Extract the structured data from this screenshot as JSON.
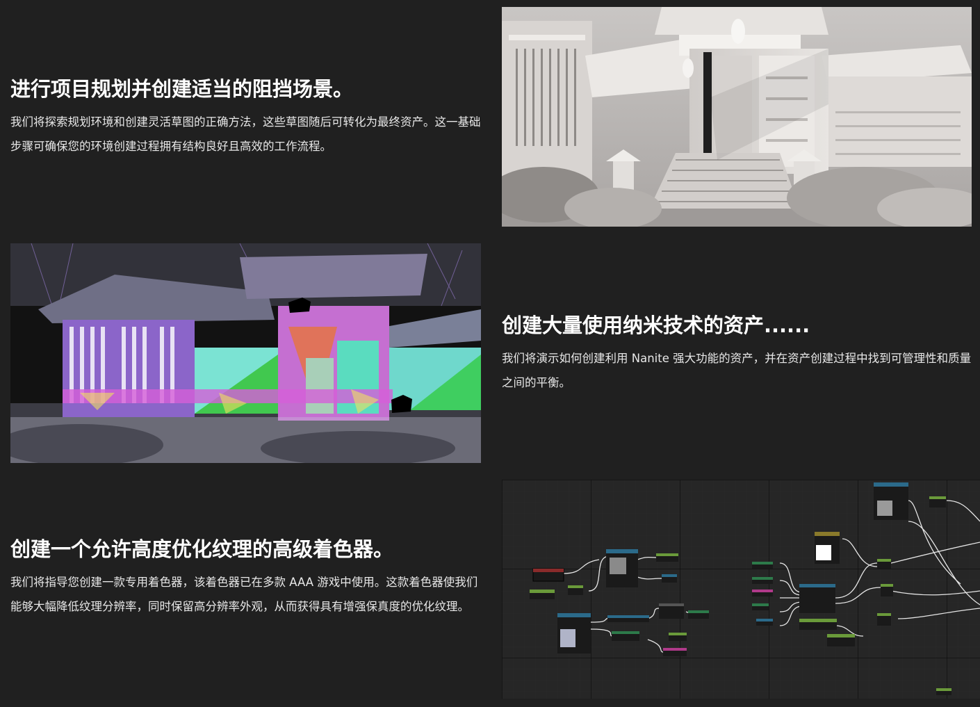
{
  "sections": [
    {
      "heading": "进行项目规划并创建适当的阻挡场景。",
      "body": "我们将探索规划环境和创建灵活草图的正确方法，这些草图随后可转化为最终资产。这一基础步骤可确保您的环境创建过程拥有结构良好且高效的工作流程。",
      "image": "clay-render-japanese-building"
    },
    {
      "heading": "创建大量使用纳米技术的资产......",
      "body": "我们将演示如何创建利用 Nanite 强大功能的资产，并在资产创建过程中找到可管理性和质量之间的平衡。",
      "image": "nanite-triangle-visualization"
    },
    {
      "heading": "创建一个允许高度优化纹理的高级着色器。",
      "body": "我们将指导您创建一款专用着色器，该着色器已在多款 AAA 游戏中使用。这款着色器使我们能够大幅降低纹理分辨率，同时保留高分辨率外观，从而获得具有增强保真度的优化纹理。",
      "image": "material-node-graph"
    }
  ]
}
